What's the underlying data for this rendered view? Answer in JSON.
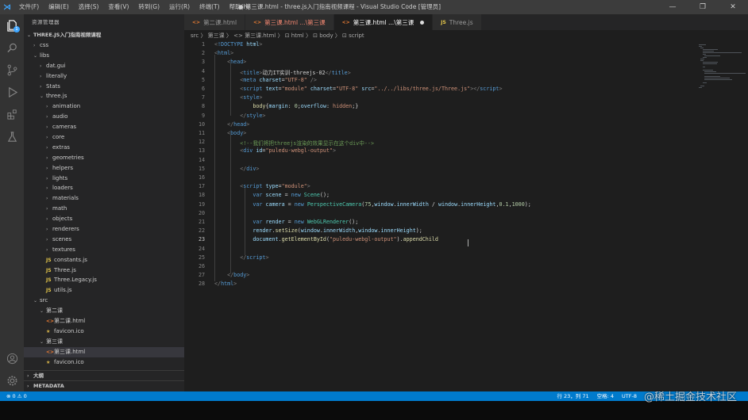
{
  "titlebar": {
    "menus": [
      "文件(F)",
      "编辑(E)",
      "选择(S)",
      "查看(V)",
      "转到(G)",
      "运行(R)",
      "终端(T)",
      "帮助(H)"
    ],
    "window_title": "● 第三课.html - three.js入门指南视频课程 - Visual Studio Code [管理员]",
    "controls": [
      "—",
      "❐",
      "✕"
    ]
  },
  "sidebar": {
    "title": "资源管理器",
    "root": "THREE.JS入门指南视频课程",
    "tree": [
      {
        "d": 1,
        "t": "f",
        "label": "css"
      },
      {
        "d": 1,
        "t": "o",
        "label": "libs"
      },
      {
        "d": 2,
        "t": "f",
        "label": "dat.gui"
      },
      {
        "d": 2,
        "t": "f",
        "label": "literally"
      },
      {
        "d": 2,
        "t": "f",
        "label": "Stats"
      },
      {
        "d": 2,
        "t": "o",
        "label": "three.js"
      },
      {
        "d": 3,
        "t": "f",
        "label": "animation"
      },
      {
        "d": 3,
        "t": "f",
        "label": "audio"
      },
      {
        "d": 3,
        "t": "f",
        "label": "cameras"
      },
      {
        "d": 3,
        "t": "f",
        "label": "core"
      },
      {
        "d": 3,
        "t": "f",
        "label": "extras"
      },
      {
        "d": 3,
        "t": "f",
        "label": "geometries"
      },
      {
        "d": 3,
        "t": "f",
        "label": "helpers"
      },
      {
        "d": 3,
        "t": "f",
        "label": "lights"
      },
      {
        "d": 3,
        "t": "f",
        "label": "loaders"
      },
      {
        "d": 3,
        "t": "f",
        "label": "materials"
      },
      {
        "d": 3,
        "t": "f",
        "label": "math"
      },
      {
        "d": 3,
        "t": "f",
        "label": "objects"
      },
      {
        "d": 3,
        "t": "f",
        "label": "renderers"
      },
      {
        "d": 3,
        "t": "f",
        "label": "scenes"
      },
      {
        "d": 3,
        "t": "f",
        "label": "textures"
      },
      {
        "d": 3,
        "t": "js",
        "label": "constants.js"
      },
      {
        "d": 3,
        "t": "js",
        "label": "Three.js"
      },
      {
        "d": 3,
        "t": "js",
        "label": "Three.Legacy.js"
      },
      {
        "d": 3,
        "t": "js",
        "label": "utils.js"
      },
      {
        "d": 1,
        "t": "o",
        "label": "src"
      },
      {
        "d": 2,
        "t": "o",
        "label": "第二课"
      },
      {
        "d": 3,
        "t": "html",
        "label": "第二课.html"
      },
      {
        "d": 3,
        "t": "ico",
        "label": "favicon.ico"
      },
      {
        "d": 2,
        "t": "o",
        "label": "第三课"
      },
      {
        "d": 3,
        "t": "html",
        "label": "第三课.html",
        "sel": true
      },
      {
        "d": 3,
        "t": "ico",
        "label": "favicon.ico"
      }
    ],
    "outline": "大纲",
    "metadata": "METADATA"
  },
  "tabs": [
    {
      "label": "第二课.html",
      "icon": "<>",
      "state": "normal"
    },
    {
      "label": "第三课.html ...\\第三课",
      "icon": "<>",
      "state": "err"
    },
    {
      "label": "第三课.html ...\\第三课",
      "icon": "<>",
      "state": "active"
    },
    {
      "label": "Three.js",
      "icon": "JS",
      "state": "normal"
    }
  ],
  "breadcrumb": "src 〉 第三课 〉 <> 第三课.html 〉 ⊡ html 〉 ⊡ body 〉 ⊡ script",
  "code": [
    [
      [
        "t-br",
        "<"
      ],
      [
        "t-tag",
        "!DOCTYPE "
      ],
      [
        "t-attr",
        "html"
      ],
      [
        "t-br",
        ">"
      ]
    ],
    [
      [
        "t-br",
        "<"
      ],
      [
        "t-tag",
        "html"
      ],
      [
        "t-br",
        ">"
      ]
    ],
    [
      [
        "t-txt",
        "    "
      ],
      [
        "t-br",
        "<"
      ],
      [
        "t-tag",
        "head"
      ],
      [
        "t-br",
        ">"
      ]
    ],
    [
      [
        "t-txt",
        "        "
      ],
      [
        "t-br",
        "<"
      ],
      [
        "t-tag",
        "title"
      ],
      [
        "t-br",
        ">"
      ],
      [
        "t-txt",
        "动力IT实训-threejs-02"
      ],
      [
        "t-br",
        "</"
      ],
      [
        "t-tag",
        "title"
      ],
      [
        "t-br",
        ">"
      ]
    ],
    [
      [
        "t-txt",
        "        "
      ],
      [
        "t-br",
        "<"
      ],
      [
        "t-tag",
        "meta "
      ],
      [
        "t-attr",
        "charset"
      ],
      [
        "t-txt",
        "="
      ],
      [
        "t-str",
        "\"UTF-8\""
      ],
      [
        "t-txt",
        " "
      ],
      [
        "t-br",
        "/>"
      ]
    ],
    [
      [
        "t-txt",
        "        "
      ],
      [
        "t-br",
        "<"
      ],
      [
        "t-tag",
        "script "
      ],
      [
        "t-attr",
        "text"
      ],
      [
        "t-txt",
        "="
      ],
      [
        "t-str",
        "\"module\""
      ],
      [
        "t-txt",
        " "
      ],
      [
        "t-attr",
        "charset"
      ],
      [
        "t-txt",
        "="
      ],
      [
        "t-str",
        "\"UTF-8\""
      ],
      [
        "t-txt",
        " "
      ],
      [
        "t-attr",
        "src"
      ],
      [
        "t-txt",
        "="
      ],
      [
        "t-str",
        "\"../../libs/three.js/Three.js\""
      ],
      [
        "t-br",
        "></"
      ],
      [
        "t-tag",
        "script"
      ],
      [
        "t-br",
        ">"
      ]
    ],
    [
      [
        "t-txt",
        "        "
      ],
      [
        "t-br",
        "<"
      ],
      [
        "t-tag",
        "style"
      ],
      [
        "t-br",
        ">"
      ]
    ],
    [
      [
        "t-txt",
        "            "
      ],
      [
        "t-fn",
        "body"
      ],
      [
        "t-txt",
        "{"
      ],
      [
        "t-var",
        "margin"
      ],
      [
        "t-txt",
        ": "
      ],
      [
        "t-num",
        "0"
      ],
      [
        "t-txt",
        ";"
      ],
      [
        "t-var",
        "overflow"
      ],
      [
        "t-txt",
        ": "
      ],
      [
        "t-str",
        "hidden"
      ],
      [
        "t-txt",
        ";}"
      ]
    ],
    [
      [
        "t-txt",
        "        "
      ],
      [
        "t-br",
        "</"
      ],
      [
        "t-tag",
        "style"
      ],
      [
        "t-br",
        ">"
      ]
    ],
    [
      [
        "t-txt",
        "    "
      ],
      [
        "t-br",
        "</"
      ],
      [
        "t-tag",
        "head"
      ],
      [
        "t-br",
        ">"
      ]
    ],
    [
      [
        "t-txt",
        "    "
      ],
      [
        "t-br",
        "<"
      ],
      [
        "t-tag",
        "body"
      ],
      [
        "t-br",
        ">"
      ]
    ],
    [
      [
        "t-txt",
        "        "
      ],
      [
        "t-com",
        "<!--我们将把threejs渲染的效果显示在这个div中-->"
      ]
    ],
    [
      [
        "t-txt",
        "        "
      ],
      [
        "t-br",
        "<"
      ],
      [
        "t-tag",
        "div "
      ],
      [
        "t-attr",
        "id"
      ],
      [
        "t-txt",
        "="
      ],
      [
        "t-str",
        "\"puledu-webgl-output\""
      ],
      [
        "t-br",
        ">"
      ]
    ],
    [
      [
        "t-txt",
        ""
      ]
    ],
    [
      [
        "t-txt",
        "        "
      ],
      [
        "t-br",
        "</"
      ],
      [
        "t-tag",
        "div"
      ],
      [
        "t-br",
        ">"
      ]
    ],
    [
      [
        "t-txt",
        ""
      ]
    ],
    [
      [
        "t-txt",
        "        "
      ],
      [
        "t-br",
        "<"
      ],
      [
        "t-tag",
        "script "
      ],
      [
        "t-attr",
        "type"
      ],
      [
        "t-txt",
        "="
      ],
      [
        "t-str",
        "\"module\""
      ],
      [
        "t-br",
        ">"
      ]
    ],
    [
      [
        "t-txt",
        "            "
      ],
      [
        "t-kw",
        "var "
      ],
      [
        "t-var",
        "scene"
      ],
      [
        "t-txt",
        " = "
      ],
      [
        "t-kw",
        "new "
      ],
      [
        "t-cls",
        "Scene"
      ],
      [
        "t-txt",
        "();"
      ]
    ],
    [
      [
        "t-txt",
        "            "
      ],
      [
        "t-kw",
        "var "
      ],
      [
        "t-var",
        "camera"
      ],
      [
        "t-txt",
        " = "
      ],
      [
        "t-kw",
        "new "
      ],
      [
        "t-cls",
        "PerspectiveCamera"
      ],
      [
        "t-txt",
        "("
      ],
      [
        "t-num",
        "75"
      ],
      [
        "t-txt",
        ","
      ],
      [
        "t-var",
        "window"
      ],
      [
        "t-txt",
        "."
      ],
      [
        "t-var",
        "innerWidth"
      ],
      [
        "t-txt",
        " / "
      ],
      [
        "t-var",
        "window"
      ],
      [
        "t-txt",
        "."
      ],
      [
        "t-var",
        "innerHeight"
      ],
      [
        "t-txt",
        ","
      ],
      [
        "t-num",
        "0.1"
      ],
      [
        "t-txt",
        ","
      ],
      [
        "t-num",
        "1000"
      ],
      [
        "t-txt",
        ");"
      ]
    ],
    [
      [
        "t-txt",
        ""
      ]
    ],
    [
      [
        "t-txt",
        "            "
      ],
      [
        "t-kw",
        "var "
      ],
      [
        "t-var",
        "render"
      ],
      [
        "t-txt",
        " = "
      ],
      [
        "t-kw",
        "new "
      ],
      [
        "t-cls",
        "WebGLRenderer"
      ],
      [
        "t-txt",
        "();"
      ]
    ],
    [
      [
        "t-txt",
        "            "
      ],
      [
        "t-var",
        "render"
      ],
      [
        "t-txt",
        "."
      ],
      [
        "t-fn",
        "setSize"
      ],
      [
        "t-txt",
        "("
      ],
      [
        "t-var",
        "window"
      ],
      [
        "t-txt",
        "."
      ],
      [
        "t-var",
        "innerWidth"
      ],
      [
        "t-txt",
        ","
      ],
      [
        "t-var",
        "window"
      ],
      [
        "t-txt",
        "."
      ],
      [
        "t-var",
        "innerHeight"
      ],
      [
        "t-txt",
        ");"
      ]
    ],
    [
      [
        "t-txt",
        "            "
      ],
      [
        "t-var",
        "document"
      ],
      [
        "t-txt",
        "."
      ],
      [
        "t-fn",
        "getElementById"
      ],
      [
        "t-txt",
        "("
      ],
      [
        "t-str",
        "\"puledu-webgl-output\""
      ],
      [
        "t-txt",
        ")."
      ],
      [
        "t-fn",
        "appendChild"
      ]
    ],
    [
      [
        "t-txt",
        ""
      ]
    ],
    [
      [
        "t-txt",
        "        "
      ],
      [
        "t-br",
        "</"
      ],
      [
        "t-tag",
        "script"
      ],
      [
        "t-br",
        ">"
      ]
    ],
    [
      [
        "t-txt",
        ""
      ]
    ],
    [
      [
        "t-txt",
        "    "
      ],
      [
        "t-br",
        "</"
      ],
      [
        "t-tag",
        "body"
      ],
      [
        "t-br",
        ">"
      ]
    ],
    [
      [
        "t-br",
        "</"
      ],
      [
        "t-tag",
        "html"
      ],
      [
        "t-br",
        ">"
      ]
    ]
  ],
  "current_line": 23,
  "status": {
    "left": "⊗ 0  ⚠ 0",
    "position": "行 23，列 71",
    "spaces": "空格: 4",
    "encoding": "UTF-8"
  },
  "watermark": "@稀土掘金技术社区"
}
